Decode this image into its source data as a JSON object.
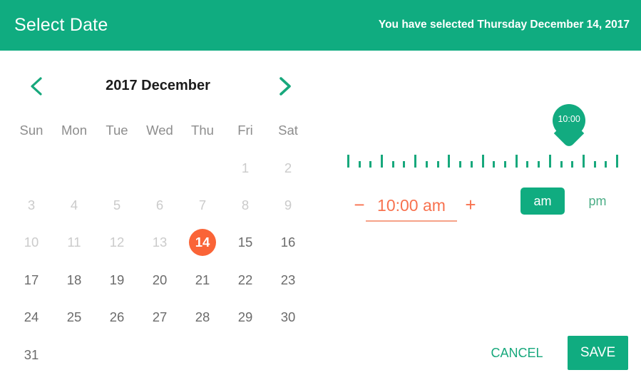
{
  "header": {
    "title": "Select Date",
    "status": "You have selected Thursday December 14, 2017",
    "bg_color": "#10ac80"
  },
  "calendar": {
    "month_label": "2017 December",
    "prev_icon": "chevron-left-icon",
    "next_icon": "chevron-right-icon",
    "accent_color": "#17a87c",
    "selected_color": "#fa6437",
    "day_names": [
      "Sun",
      "Mon",
      "Tue",
      "Wed",
      "Thu",
      "Fri",
      "Sat"
    ],
    "selected_day": 14,
    "weeks": [
      [
        {
          "label": "",
          "state": "empty"
        },
        {
          "label": "",
          "state": "empty"
        },
        {
          "label": "",
          "state": "empty"
        },
        {
          "label": "",
          "state": "empty"
        },
        {
          "label": "",
          "state": "empty"
        },
        {
          "label": "1",
          "state": "disabled"
        },
        {
          "label": "2",
          "state": "disabled"
        }
      ],
      [
        {
          "label": "3",
          "state": "disabled"
        },
        {
          "label": "4",
          "state": "disabled"
        },
        {
          "label": "5",
          "state": "disabled"
        },
        {
          "label": "6",
          "state": "disabled"
        },
        {
          "label": "7",
          "state": "disabled"
        },
        {
          "label": "8",
          "state": "disabled"
        },
        {
          "label": "9",
          "state": "disabled"
        }
      ],
      [
        {
          "label": "10",
          "state": "disabled"
        },
        {
          "label": "11",
          "state": "disabled"
        },
        {
          "label": "12",
          "state": "disabled"
        },
        {
          "label": "13",
          "state": "disabled"
        },
        {
          "label": "14",
          "state": "selected"
        },
        {
          "label": "15",
          "state": "enabled"
        },
        {
          "label": "16",
          "state": "enabled"
        }
      ],
      [
        {
          "label": "17",
          "state": "enabled"
        },
        {
          "label": "18",
          "state": "enabled"
        },
        {
          "label": "19",
          "state": "enabled"
        },
        {
          "label": "20",
          "state": "enabled"
        },
        {
          "label": "21",
          "state": "enabled"
        },
        {
          "label": "22",
          "state": "enabled"
        },
        {
          "label": "23",
          "state": "enabled"
        }
      ],
      [
        {
          "label": "24",
          "state": "enabled"
        },
        {
          "label": "25",
          "state": "enabled"
        },
        {
          "label": "26",
          "state": "enabled"
        },
        {
          "label": "27",
          "state": "enabled"
        },
        {
          "label": "28",
          "state": "enabled"
        },
        {
          "label": "29",
          "state": "enabled"
        },
        {
          "label": "30",
          "state": "enabled"
        }
      ],
      [
        {
          "label": "31",
          "state": "enabled"
        },
        {
          "label": "",
          "state": "empty"
        },
        {
          "label": "",
          "state": "empty"
        },
        {
          "label": "",
          "state": "empty"
        },
        {
          "label": "",
          "state": "empty"
        },
        {
          "label": "",
          "state": "empty"
        },
        {
          "label": "",
          "state": "empty"
        }
      ]
    ]
  },
  "time_picker": {
    "slider": {
      "pin_label": "10:00",
      "pin_position_percent": 82,
      "tick_color": "#17a87c",
      "ticks": [
        {
          "pos": 0,
          "tall": true
        },
        {
          "pos": 4.17,
          "tall": false
        },
        {
          "pos": 8.33,
          "tall": false
        },
        {
          "pos": 12.5,
          "tall": true
        },
        {
          "pos": 16.7,
          "tall": false
        },
        {
          "pos": 20.8,
          "tall": false
        },
        {
          "pos": 25.0,
          "tall": true
        },
        {
          "pos": 29.2,
          "tall": false
        },
        {
          "pos": 33.3,
          "tall": false
        },
        {
          "pos": 37.5,
          "tall": true
        },
        {
          "pos": 41.7,
          "tall": false
        },
        {
          "pos": 45.8,
          "tall": false
        },
        {
          "pos": 50.0,
          "tall": true
        },
        {
          "pos": 54.2,
          "tall": false
        },
        {
          "pos": 58.3,
          "tall": false
        },
        {
          "pos": 62.5,
          "tall": true
        },
        {
          "pos": 66.7,
          "tall": false
        },
        {
          "pos": 70.8,
          "tall": false
        },
        {
          "pos": 75.0,
          "tall": true
        },
        {
          "pos": 79.2,
          "tall": false
        },
        {
          "pos": 83.3,
          "tall": false
        },
        {
          "pos": 87.5,
          "tall": true
        },
        {
          "pos": 91.7,
          "tall": false
        },
        {
          "pos": 95.8,
          "tall": false
        },
        {
          "pos": 100,
          "tall": true
        }
      ]
    },
    "decrement_label": "−",
    "increment_label": "+",
    "time_value": "10:00 am",
    "time_color": "#f8724f",
    "am_label": "am",
    "pm_label": "pm",
    "meridiem_selected": "am"
  },
  "actions": {
    "cancel_label": "CANCEL",
    "save_label": "SAVE"
  }
}
